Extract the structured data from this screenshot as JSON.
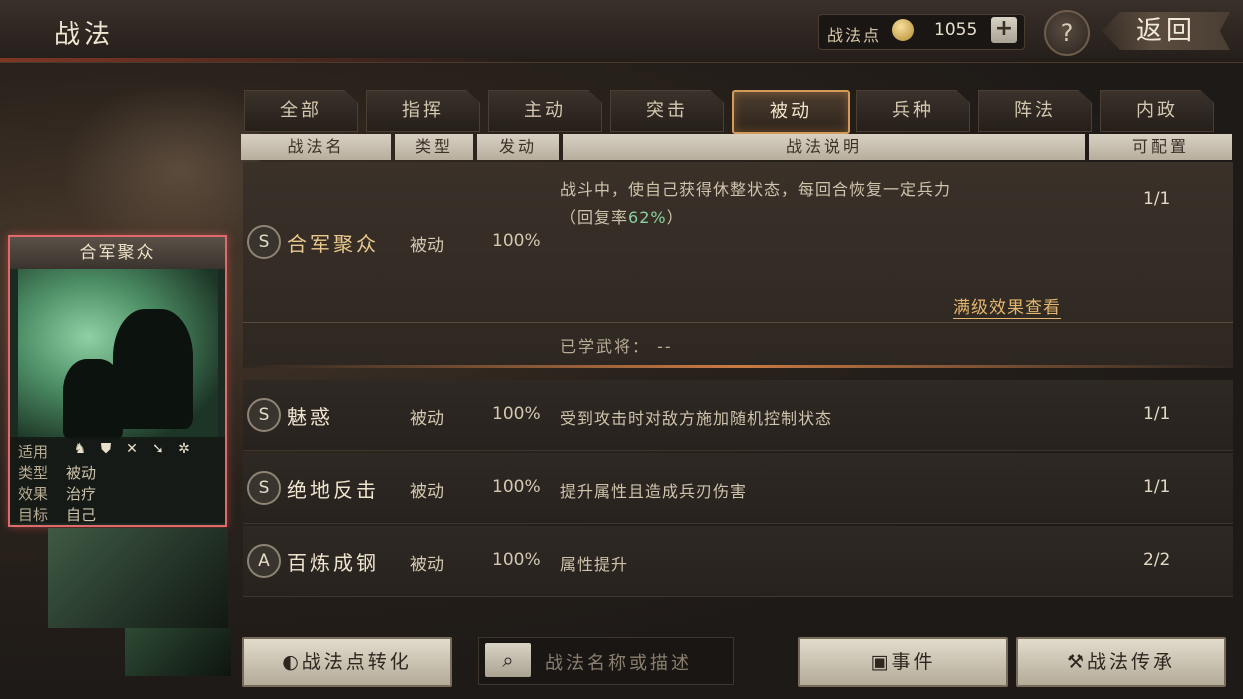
{
  "header": {
    "title": "战法",
    "points_label": "战法点",
    "points_value": "1055",
    "plus": "+",
    "help": "?",
    "back": "返回"
  },
  "tabs": [
    "全部",
    "指挥",
    "主动",
    "突击",
    "被动",
    "兵种",
    "阵法",
    "内政"
  ],
  "active_tab": "被动",
  "columns": [
    "战法名",
    "类型",
    "发动",
    "战法说明",
    "可配置"
  ],
  "card": {
    "name": "合军聚众",
    "apply_label": "适用",
    "type_label": "类型",
    "type_value": "被动",
    "effect_label": "效果",
    "effect_value": "治疗",
    "target_label": "目标",
    "target_value": "自己",
    "apply_icons": [
      "cavalry-icon",
      "shield-icon",
      "bow-icon",
      "spear-icon",
      "wheel-icon"
    ]
  },
  "expanded": {
    "grade": "S",
    "name": "合军聚众",
    "type": "被动",
    "rate": "100%",
    "desc1": "战斗中，使自己获得休整状态，每回合恢复一定兵力",
    "desc2_prefix": "（回复率",
    "desc2_value": "62%",
    "desc2_suffix": "）",
    "config": "1/1",
    "full_effect_link": "满级效果查看",
    "learned_label": "已学武将：",
    "learned_value": "--"
  },
  "rows": [
    {
      "grade": "S",
      "name": "魅惑",
      "type": "被动",
      "rate": "100%",
      "desc": "受到攻击时对敌方施加随机控制状态",
      "config": "1/1"
    },
    {
      "grade": "S",
      "name": "绝地反击",
      "type": "被动",
      "rate": "100%",
      "desc": "提升属性且造成兵刃伤害",
      "config": "1/1"
    },
    {
      "grade": "A",
      "name": "百炼成钢",
      "type": "被动",
      "rate": "100%",
      "desc": "属性提升",
      "config": "2/2"
    }
  ],
  "buttons": {
    "convert": "战法点转化",
    "event": "事件",
    "inherit": "战法传承"
  },
  "search": {
    "placeholder": "战法名称或描述"
  },
  "colors": {
    "accent_gold": "#e2b66e",
    "active_tab_border": "#d29a5b",
    "card_border": "#e06a6a",
    "recovery_green": "#8bd1a0"
  }
}
